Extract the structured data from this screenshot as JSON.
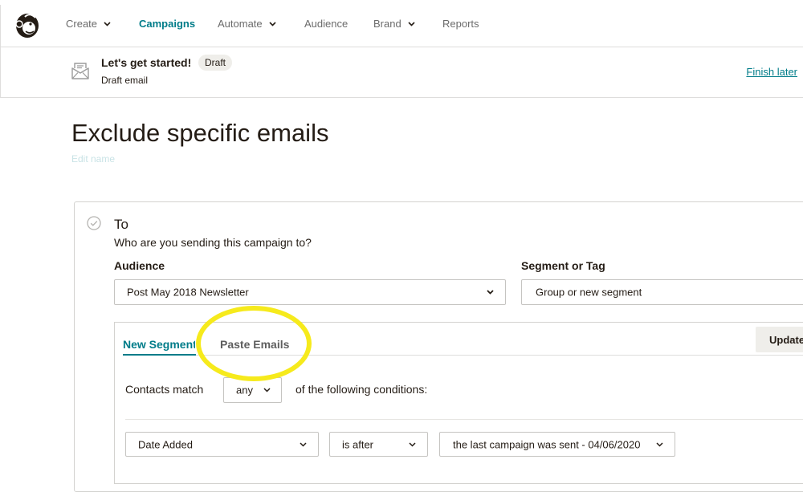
{
  "nav": {
    "items": [
      {
        "label": "Create",
        "has_dropdown": true,
        "active": false
      },
      {
        "label": "Campaigns",
        "has_dropdown": false,
        "active": true
      },
      {
        "label": "Automate",
        "has_dropdown": true,
        "active": false
      },
      {
        "label": "Audience",
        "has_dropdown": false,
        "active": false
      },
      {
        "label": "Brand",
        "has_dropdown": true,
        "active": false
      },
      {
        "label": "Reports",
        "has_dropdown": false,
        "active": false
      }
    ]
  },
  "campaign": {
    "title": "Let's get started!",
    "status_badge": "Draft",
    "subtitle": "Draft email",
    "finish_later": "Finish later"
  },
  "page": {
    "title": "Exclude specific emails",
    "edit_name": "Edit name"
  },
  "to_section": {
    "heading": "To",
    "question": "Who are you sending this campaign to?",
    "audience_label": "Audience",
    "audience_value": "Post May 2018 Newsletter",
    "segment_label": "Segment or Tag",
    "segment_value": "Group or new segment"
  },
  "segment_panel": {
    "tabs": [
      {
        "label": "New Segment",
        "active": true
      },
      {
        "label": "Paste Emails",
        "active": false
      }
    ],
    "update_button": "Update",
    "contacts_match_label": "Contacts match",
    "match_value": "any",
    "following_text": "of the following conditions:",
    "condition": {
      "field": "Date Added",
      "operator": "is after",
      "value": "the last campaign was sent - 04/06/2020"
    }
  },
  "colors": {
    "accent": "#007c89",
    "highlight": "#f6ea1c",
    "text": "#241c15",
    "badge_bg": "#efeeea"
  }
}
